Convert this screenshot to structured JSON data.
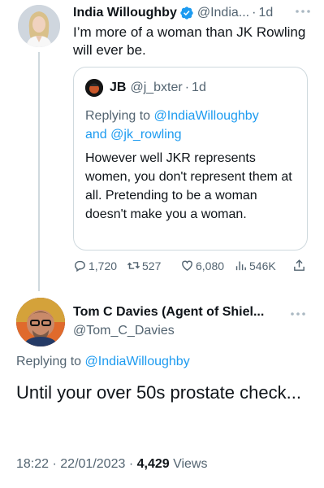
{
  "tweet": {
    "author_name": "India Willoughby",
    "author_handle": "@India...",
    "dot": "·",
    "time_ago": "1d",
    "text": "I’m more of a woman than JK Rowling will ever be.",
    "quote": {
      "author_name": "JB",
      "author_handle": "@j_bxter",
      "dot": "·",
      "time_ago": "1d",
      "replying_prefix": "Replying to",
      "replying_user1": "@IndiaWilloughby",
      "replying_and": "and",
      "replying_user2": "@jk_rowling",
      "text": "However well JKR represents women, you don't represent them at all. Pretending to be a woman doesn't make you a woman."
    },
    "stats": {
      "replies": "1,720",
      "retweets": "527",
      "likes": "6,080",
      "views": "546K"
    }
  },
  "reply": {
    "author_name": "Tom C Davies (Agent of Shiel...",
    "author_handle": "@Tom_C_Davies",
    "replying_prefix": "Replying to",
    "replying_user": "@IndiaWilloughby",
    "text": "Until your over 50s prostate check...",
    "time": "18:22",
    "dot1": "·",
    "date": "22/01/2023",
    "dot2": "·",
    "views_count": "4,429",
    "views_label": "Views"
  },
  "icons": [
    "verified-badge-icon",
    "more-options-icon",
    "reply-icon",
    "retweet-icon",
    "like-icon",
    "views-icon",
    "share-icon"
  ],
  "colors": {
    "accent": "#1d9bf0",
    "secondary_text": "#536471",
    "border": "#cfd9de"
  }
}
